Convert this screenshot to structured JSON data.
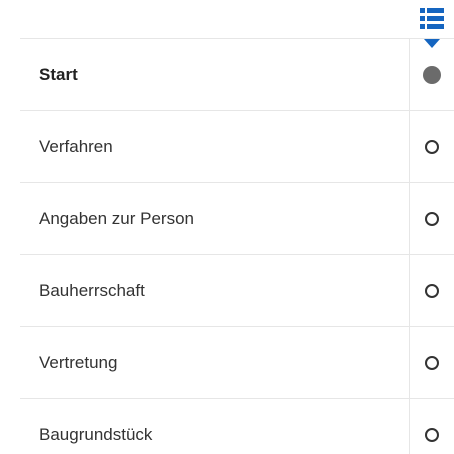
{
  "toggle": {
    "icon": "list-icon",
    "color": "#1565c0"
  },
  "steps": [
    {
      "label": "Start",
      "status": "current"
    },
    {
      "label": "Verfahren",
      "status": "pending"
    },
    {
      "label": "Angaben zur Person",
      "status": "pending"
    },
    {
      "label": "Bauherrschaft",
      "status": "pending"
    },
    {
      "label": "Vertretung",
      "status": "pending"
    },
    {
      "label": "Baugrundstück",
      "status": "pending"
    }
  ]
}
